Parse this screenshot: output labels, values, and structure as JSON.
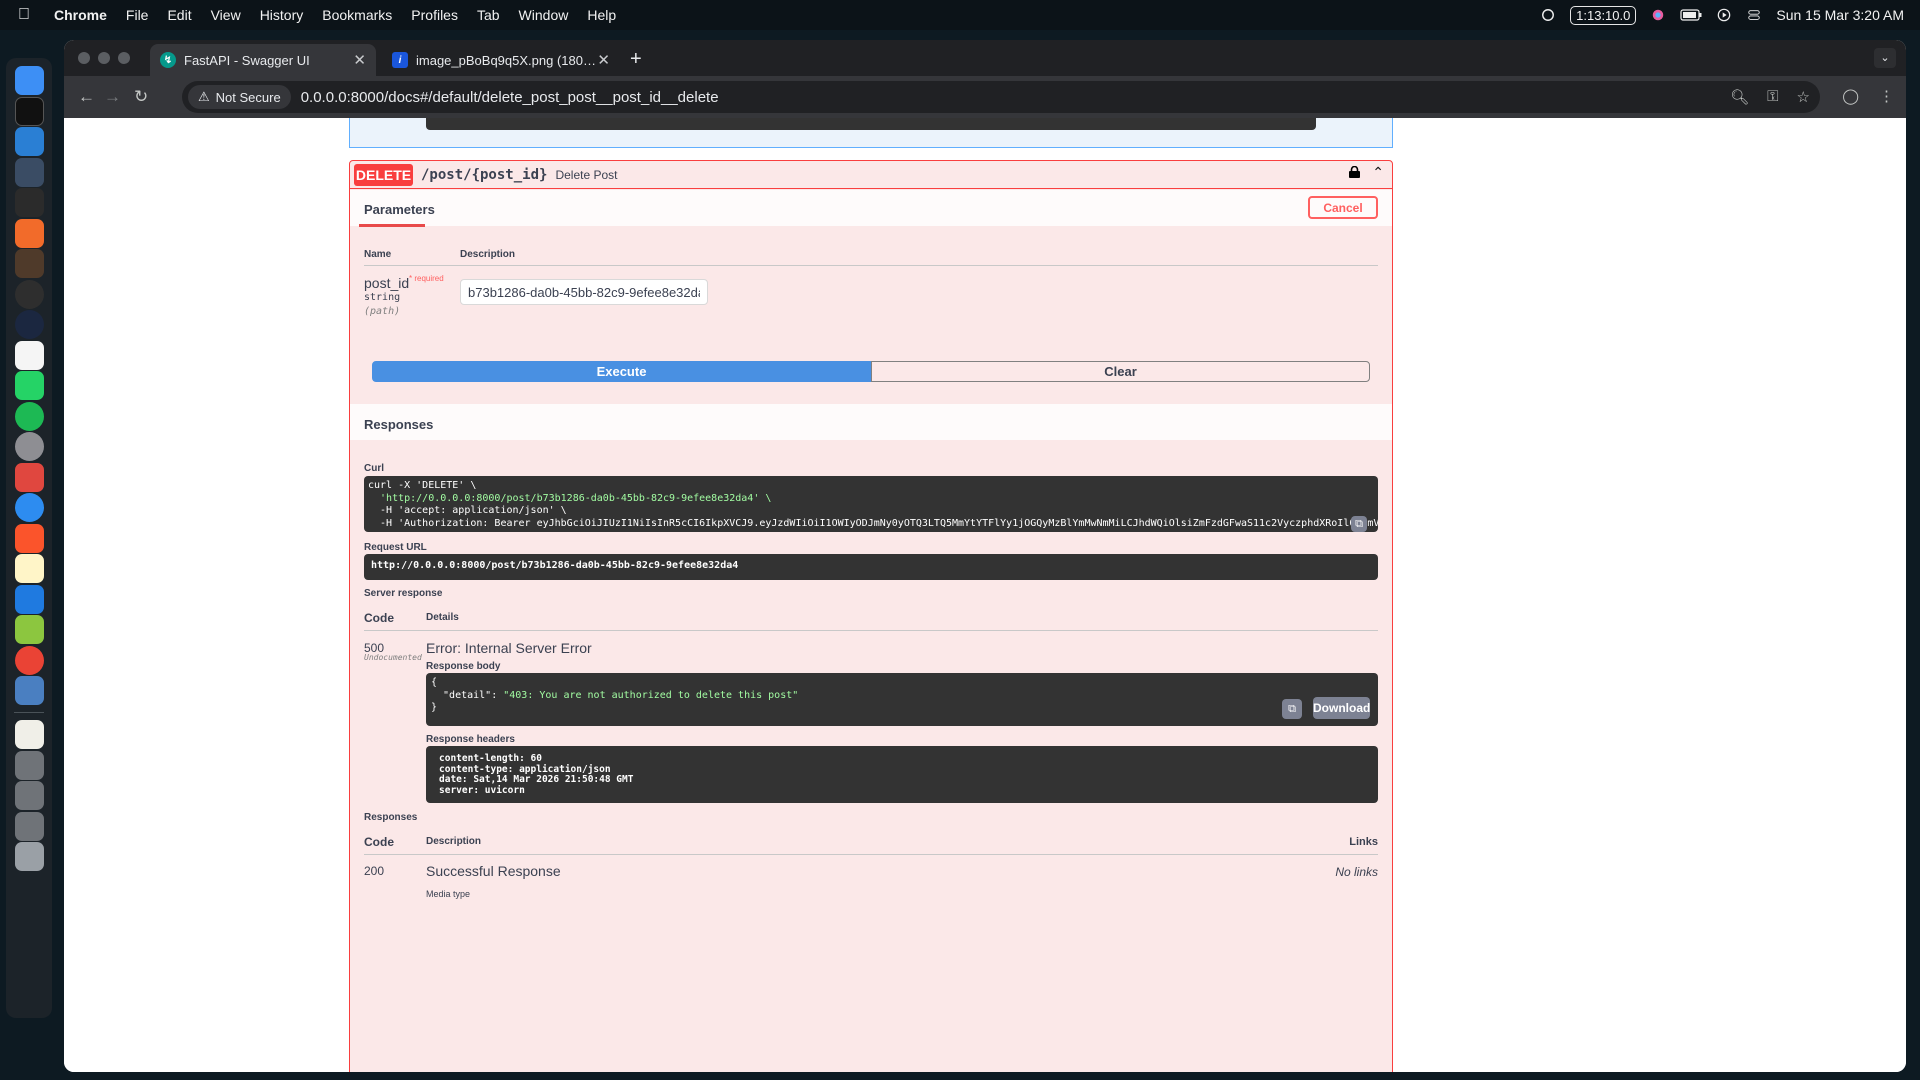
{
  "menubar": {
    "app_name": "Chrome",
    "items": [
      "File",
      "Edit",
      "View",
      "History",
      "Bookmarks",
      "Profiles",
      "Tab",
      "Window",
      "Help"
    ],
    "timer": "1:13:10.0",
    "datetime": "Sun 15 Mar  3:20 AM"
  },
  "browser": {
    "tabs": [
      {
        "title": "FastAPI - Swagger UI",
        "active": true
      },
      {
        "title": "image_pBoBq9q5X.png (180…",
        "active": false
      }
    ],
    "security_label": "Not Secure",
    "url": "0.0.0.0:8000/docs#/default/delete_post_post__post_id__delete"
  },
  "operation": {
    "method": "DELETE",
    "path": "/post/{post_id}",
    "summary": "Delete Post",
    "parameters_tab": "Parameters",
    "cancel_label": "Cancel",
    "col_name": "Name",
    "col_description": "Description",
    "param": {
      "name": "post_id",
      "required_mark": "* required",
      "type": "string",
      "in": "(path)",
      "value": "b73b1286-da0b-45bb-82c9-9efee8e32da4"
    },
    "execute_label": "Execute",
    "clear_label": "Clear"
  },
  "responses_section": {
    "title": "Responses",
    "curl_label": "Curl",
    "curl_lines": [
      "curl -X 'DELETE' \\",
      "  'http://0.0.0.0:8000/post/b73b1286-da0b-45bb-82c9-9efee8e32da4' \\",
      "  -H 'accept: application/json' \\",
      "  -H 'Authorization: Bearer eyJhbGciOiJIUzI1NiIsInR5cCI6IkpXVCJ9.eyJzdWIiOiI1OWIyODJmNy0yOTQ3LTQ5MmYtYTFlYy1jOGQyMzBlYmMwNmMiLCJhdWQiOlsiZmFzdGFwaS11c2VyczphdXRoIl0sImV4cCI6MTc3MzUyODU4Mn0.8"
    ],
    "request_url_label": "Request URL",
    "request_url": "http://0.0.0.0:8000/post/b73b1286-da0b-45bb-82c9-9efee8e32da4",
    "server_response_label": "Server response",
    "col_code": "Code",
    "col_details": "Details",
    "status_code": "500",
    "undocumented": "Undocumented",
    "error_title": "Error: Internal Server Error",
    "response_body_label": "Response body",
    "response_body": {
      "open": "{",
      "key": "  \"detail\": ",
      "value": "\"403: You are not authorized to delete this post\"",
      "close": "}"
    },
    "download_label": "Download",
    "response_headers_label": "Response headers",
    "response_headers": [
      "content-length: 60",
      "content-type: application/json",
      "date: Sat,14 Mar 2026 21:50:48 GMT",
      "server: uvicorn"
    ]
  },
  "documented_responses": {
    "title": "Responses",
    "col_code": "Code",
    "col_description": "Description",
    "col_links": "Links",
    "rows": [
      {
        "code": "200",
        "description": "Successful Response",
        "links": "No links"
      }
    ],
    "media_type_label": "Media type"
  }
}
